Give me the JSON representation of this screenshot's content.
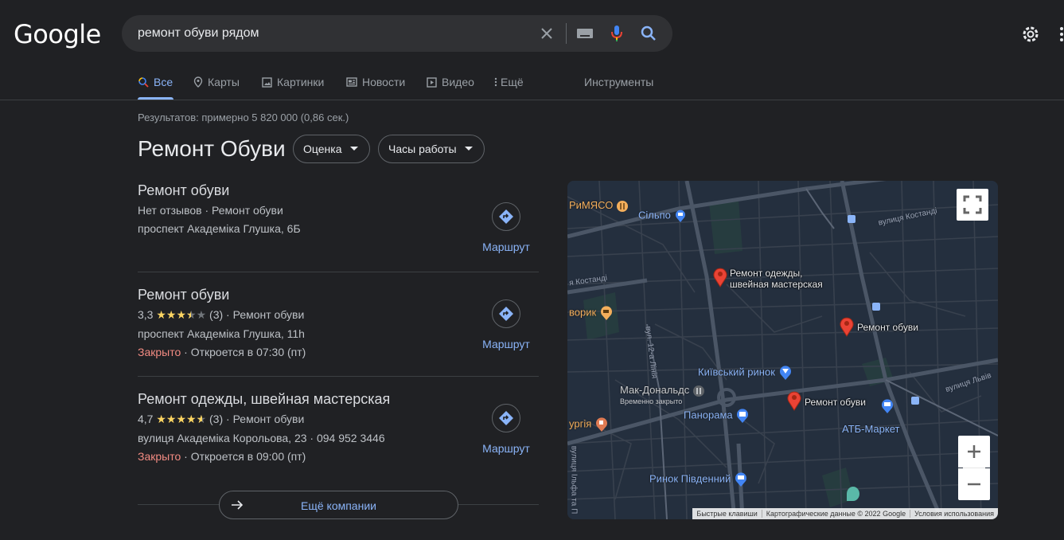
{
  "logo": "Google",
  "search": {
    "query": "ремонт обуви рядом"
  },
  "tabs": [
    {
      "label": "Все"
    },
    {
      "label": "Карты"
    },
    {
      "label": "Картинки"
    },
    {
      "label": "Новости"
    },
    {
      "label": "Видео"
    },
    {
      "label": "Ещё"
    },
    {
      "label": "Инструменты"
    }
  ],
  "result_stats": "Результатов: примерно 5 820 000 (0,86 сек.)",
  "local": {
    "title": "Ремонт Обуви",
    "chips": [
      {
        "label": "Оценка"
      },
      {
        "label": "Часы работы"
      }
    ],
    "listings": [
      {
        "name": "Ремонт обуви",
        "line1": "Нет отзывов · Ремонт обуви",
        "address": "проспект Академіка Глушка, 6Б",
        "route": "Маршрут"
      },
      {
        "name": "Ремонт обуви",
        "rating": "3,3",
        "reviews": "(3)",
        "category": "· Ремонт обуви",
        "address": "проспект Академіка Глушка, 11h",
        "status": "Закрыто",
        "hours": "· Откроется в 07:30 (пт)",
        "route": "Маршрут"
      },
      {
        "name": "Ремонт одежды, швейная мастерская",
        "rating": "4,7",
        "reviews": "(3)",
        "category": "· Ремонт обуви",
        "address": "вулиця Академіка Корольова, 23 · 094 952 3446",
        "status": "Закрыто",
        "hours": "· Откроется в 09:00 (пт)",
        "route": "Маршрут"
      }
    ],
    "more": "Ещё компании"
  },
  "map": {
    "pins": [
      {
        "label_line1": "Ремонт одежды,",
        "label_line2": "швейная мастерская"
      },
      {
        "label_line1": "Ремонт обуви"
      },
      {
        "label_line1": "Ремонт обуви"
      }
    ],
    "pois": {
      "rimyaso": "РиМЯСО",
      "silpo": "Сільпо",
      "dvorik": "ворик",
      "kyiv_market": "Київський ринок",
      "mcdonalds": "Мак-Дональдс",
      "mcdonalds_sub": "Временно закрыто",
      "panorama": "Панорама",
      "atb": "АТБ-Маркет",
      "burgiya": "ургія",
      "south_market": "Ринок Південний"
    },
    "streets": {
      "kostandi_top": "вулиця Костанді",
      "kostandi_left": "я Костанді",
      "ilfa": "вулиця Ільфа та П",
      "line12a": "вул. 12-а Лінія",
      "lvivska": "вулиця Львів"
    },
    "attribution": [
      "Быстрые клавиши",
      "Картографические данные © 2022 Google",
      "Условия использования"
    ],
    "colors": {
      "pin": "#ea4335",
      "poi_blue": "#8ab4f8",
      "food": "#f3ae5b",
      "map_bg": "#242f3e",
      "road": "#4b5666"
    }
  }
}
